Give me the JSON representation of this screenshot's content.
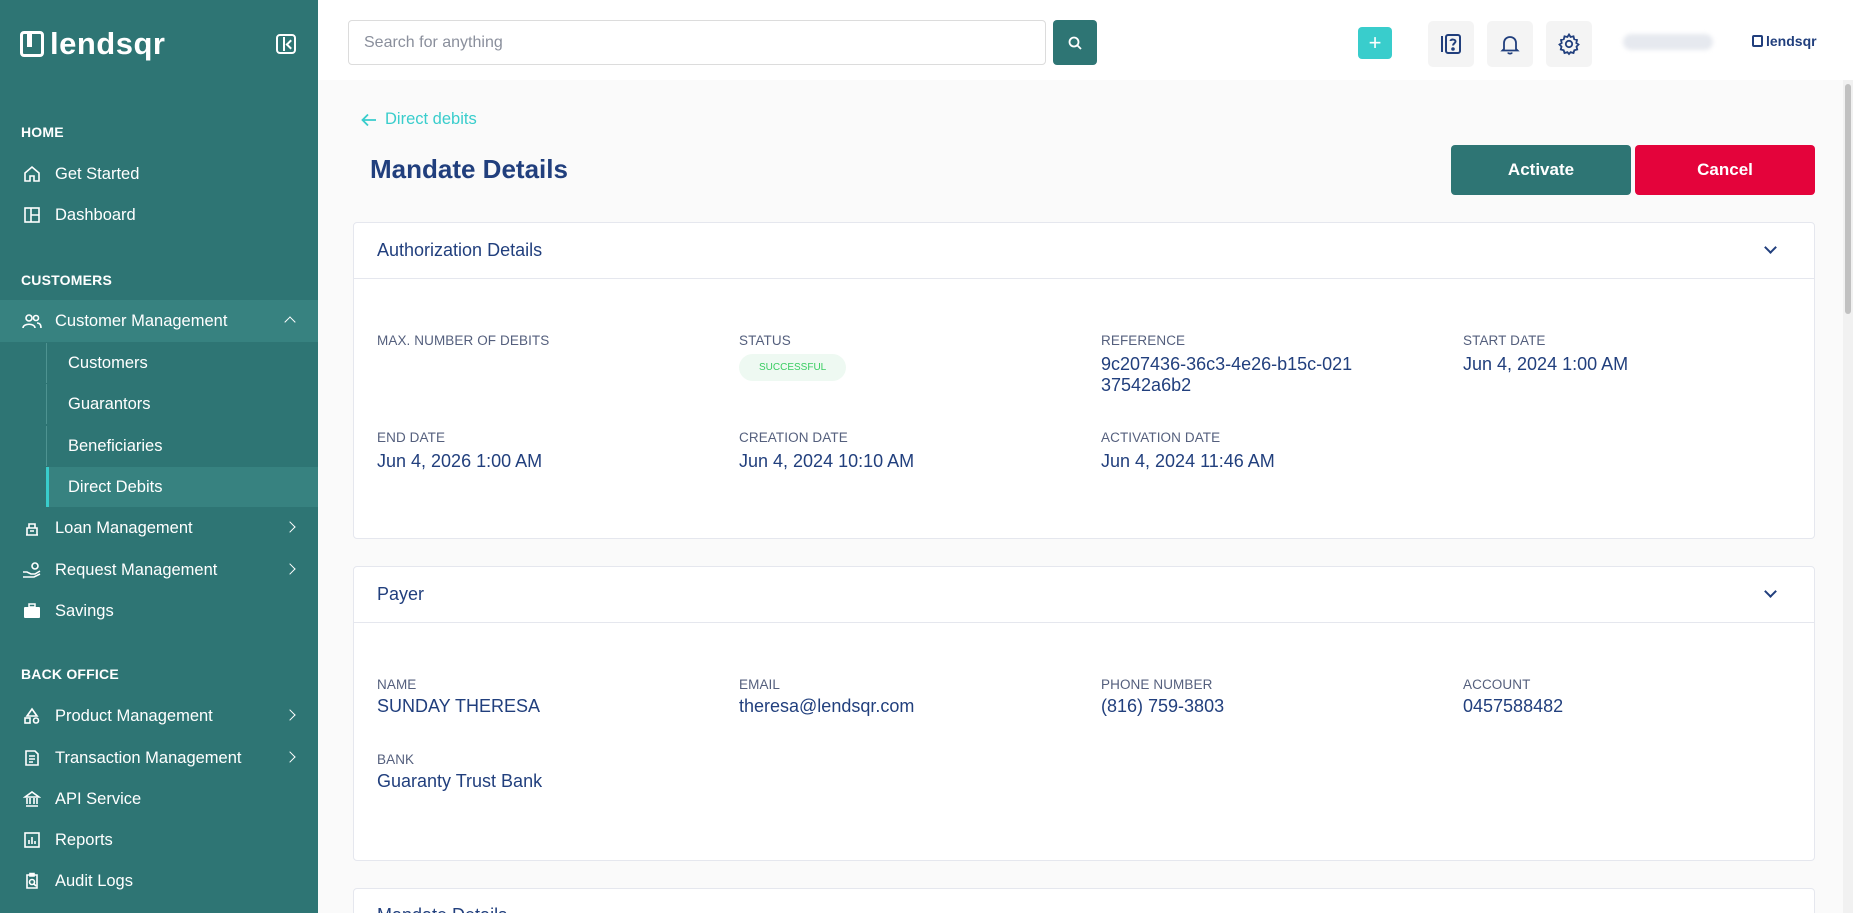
{
  "brand": {
    "name": "lendsqr"
  },
  "sidebar": {
    "sections": [
      {
        "title": "HOME"
      },
      {
        "title": "CUSTOMERS"
      },
      {
        "title": "BACK OFFICE"
      }
    ],
    "items": {
      "get_started": "Get Started",
      "dashboard": "Dashboard",
      "customer_management": "Customer Management",
      "customers": "Customers",
      "guarantors": "Guarantors",
      "beneficiaries": "Beneficiaries",
      "direct_debits": "Direct Debits",
      "loan_management": "Loan Management",
      "request_management": "Request Management",
      "savings": "Savings",
      "product_management": "Product Management",
      "transaction_management": "Transaction Management",
      "api_service": "API Service",
      "reports": "Reports",
      "audit_logs": "Audit Logs"
    }
  },
  "topbar": {
    "search_placeholder": "Search for anything",
    "plus_label": "+",
    "logo_text": "lendsqr"
  },
  "page": {
    "back_link": "Direct debits",
    "title": "Mandate Details",
    "activate_label": "Activate",
    "cancel_label": "Cancel"
  },
  "authorization": {
    "title": "Authorization Details",
    "max_debits_label": "MAX. NUMBER OF DEBITS",
    "max_debits_value": "",
    "status_label": "STATUS",
    "status_value": "SUCCESSFUL",
    "reference_label": "REFERENCE",
    "reference_value": "9c207436-36c3-4e26-b15c-02137542a6b2",
    "start_date_label": "START DATE",
    "start_date_value": "Jun 4, 2024 1:00 AM",
    "end_date_label": "END DATE",
    "end_date_value": "Jun 4, 2026 1:00 AM",
    "creation_date_label": "CREATION DATE",
    "creation_date_value": "Jun 4, 2024 10:10 AM",
    "activation_date_label": "ACTIVATION DATE",
    "activation_date_value": "Jun 4, 2024 11:46 AM"
  },
  "payer": {
    "title": "Payer",
    "name_label": "NAME",
    "name_value": "SUNDAY THERESA",
    "email_label": "EMAIL",
    "email_value": "theresa@lendsqr.com",
    "phone_label": "PHONE NUMBER",
    "phone_value": "(816) 759-3803",
    "account_label": "ACCOUNT",
    "account_value": "0457588482",
    "bank_label": "BANK",
    "bank_value": "Guaranty Trust Bank"
  },
  "mandate": {
    "title": "Mandate Details"
  },
  "colors": {
    "sidebar": "#2e7574",
    "accent": "#39cdcc",
    "primary_text": "#213f7d",
    "danger": "#e4033b",
    "success": "#39cd62"
  }
}
